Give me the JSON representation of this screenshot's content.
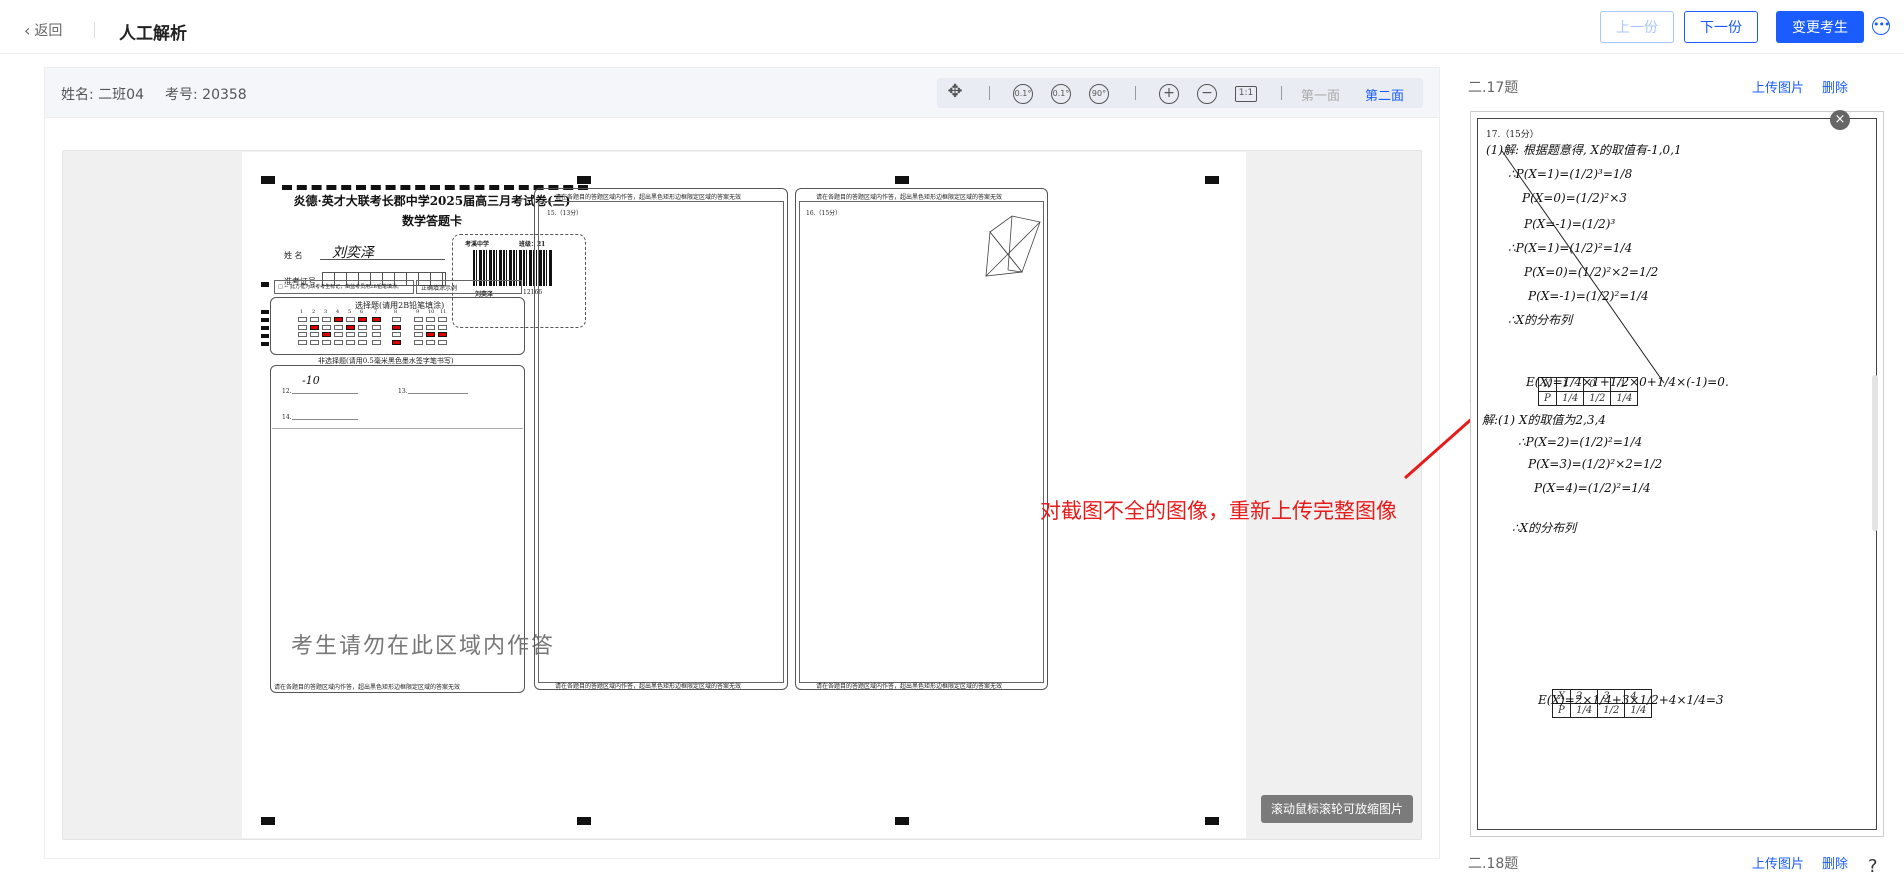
{
  "header": {
    "back_label": "返回",
    "title": "人工解析",
    "prev_label": "上一份",
    "next_label": "下一份",
    "change_label": "变更考生"
  },
  "student": {
    "name": "姓名: 二班04",
    "number": "考号: 20358"
  },
  "toolbar": {
    "face1": "第一面",
    "face2": "第二面",
    "rot_left": "0.1°",
    "rot_right": "0.1°",
    "rot_90": "90°",
    "ratio": "1:1"
  },
  "viewer": {
    "zoom_tip": "滚动鼠标滚轮可放缩图片"
  },
  "sheet": {
    "exam_title": "炎德·英才大联考长郡中学2025届高三月考试卷(三)",
    "card_title": "数学答题卡",
    "name_label": "姓    名",
    "name_value": "刘奕泽",
    "ticket_label": "准考证号",
    "school": "考溪中学",
    "class": "班级：21",
    "barcode_name": "刘奕泽",
    "barcode_no": "12166",
    "notice": "□ ← 此方框为缺考考生标记，由监考员用2B铅笔填涂。",
    "sample": "正确填涂示例",
    "choice_title": "选择题(请用2B铅笔填涂)",
    "nonchoice_title": "非选择题(请用0.5毫米黑色墨水签字笔书写)",
    "q12": "12.",
    "q12_answer": "-10",
    "q13": "13.",
    "q14": "14.",
    "no_answer": "考生请勿在此区域内作答",
    "area_notice": "请在各题目的答题区域内作答，超出黑色矩形边框限定区域的答案无效",
    "q15": "15.（13分）",
    "q16": "16.（15分）",
    "choice_numbers": [
      "1",
      "2",
      "3",
      "4",
      "5",
      "6",
      "7",
      "8",
      "9",
      "10",
      "11"
    ]
  },
  "right": {
    "q17_label": "二.17题",
    "q18_label": "二.18题",
    "upload_label": "上传图片",
    "delete_label": "删除",
    "q17_head": "17.（15分）",
    "hw_lines": [
      "(1)解: 根据题意得, X的取值有-1,0,1",
      "∴P(X=1)=(1/2)³=1/8",
      "P(X=0)=(1/2)²×3",
      "P(X=-1)=(1/2)³",
      "∴P(X=1)=(1/2)²=1/4",
      "P(X=0)=(1/2)²×2=1/2",
      "P(X=-1)=(1/2)²=1/4",
      "∴X的分布列",
      "E(X)=1/4×1+1/2×0+1/4×(-1)=0.",
      "解:(1) X的取值为2,3,4",
      "∴P(X=2)=(1/2)²=1/4",
      "P(X=3)=(1/2)²×2=1/2",
      "P(X=4)=(1/2)²=1/4",
      "∴X的分布列",
      "E(X)=2×1/4+3×1/2+4×1/4=3"
    ],
    "table1": [
      [
        "X",
        "1",
        "0",
        "-1"
      ],
      [
        "P",
        "1/4",
        "1/2",
        "1/4"
      ]
    ],
    "table2": [
      [
        "X",
        "2",
        "3",
        "4"
      ],
      [
        "P",
        "1/4",
        "1/2",
        "1/4"
      ]
    ]
  },
  "annotation": {
    "text": "对截图不全的图像，重新上传完整图像",
    "color": "#e61c1c"
  },
  "colors": {
    "accent": "#1a5cff",
    "fill_mark": "#d00000"
  }
}
